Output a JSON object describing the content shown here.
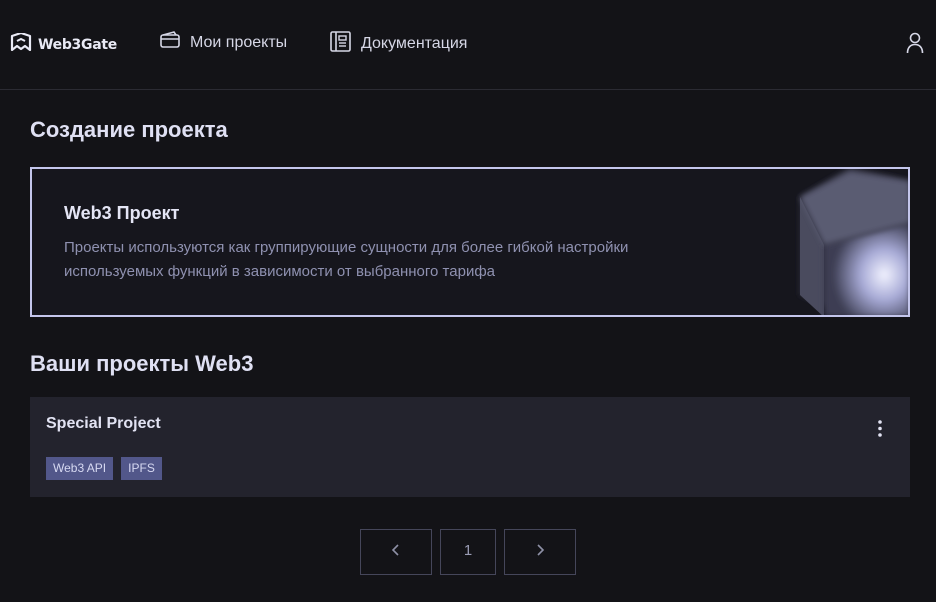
{
  "header": {
    "logo_text": "Web3Gate",
    "nav": [
      {
        "label": "Мои проекты",
        "icon": "wallet-icon"
      },
      {
        "label": "Документация",
        "icon": "docs-icon"
      }
    ],
    "user_icon": "user-icon"
  },
  "create_section": {
    "heading": "Создание проекта",
    "card_title": "Web3 Проект",
    "card_description": "Проекты используются как группирующие сущности для более гибкой настройки используемых функций в зависимости от выбранного тарифа"
  },
  "projects_section": {
    "heading": "Ваши проекты Web3",
    "projects": [
      {
        "name": "Special Project",
        "tags": [
          "Web3 API",
          "IPFS"
        ]
      }
    ]
  },
  "pagination": {
    "current_page": "1",
    "prev_icon": "chevron-left-icon",
    "next_icon": "chevron-right-icon"
  },
  "colors": {
    "background": "#131317",
    "card_border": "#c4c6ec",
    "project_card": "#23232d",
    "tag": "#52578a"
  }
}
